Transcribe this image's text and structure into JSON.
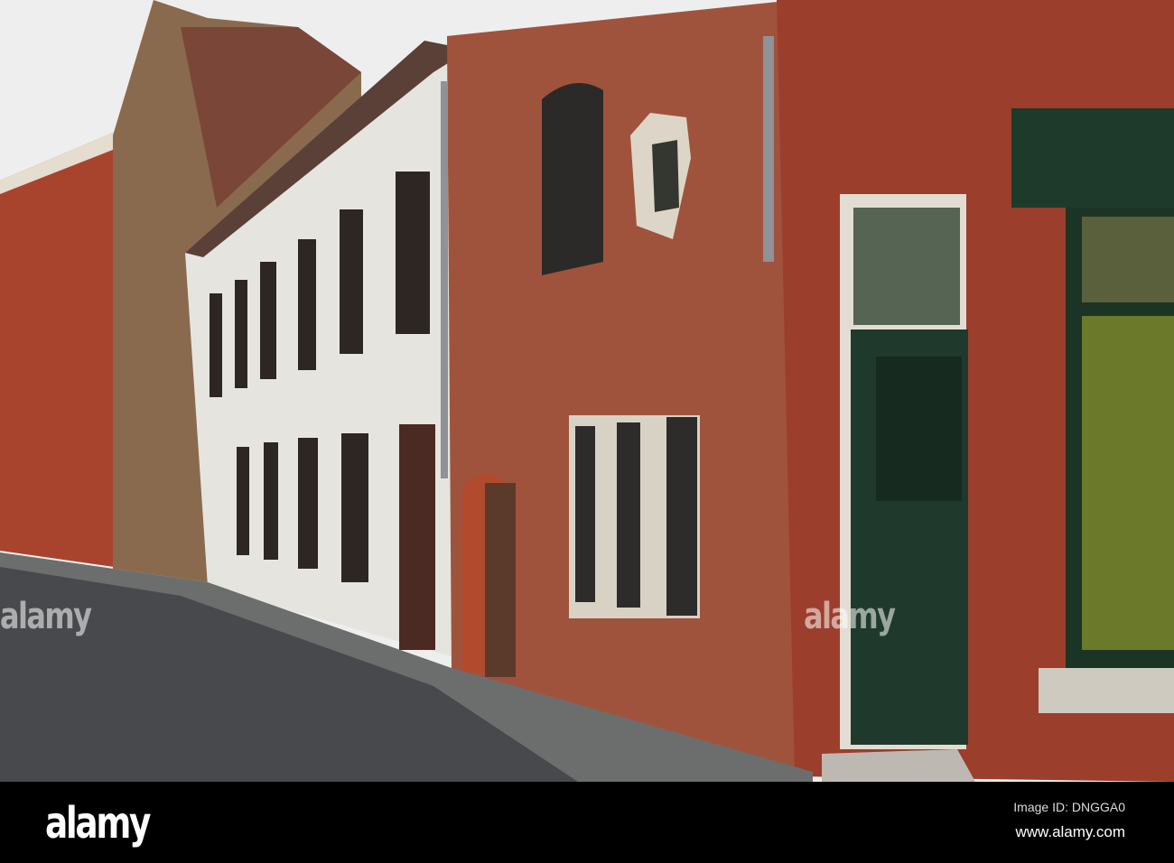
{
  "photo": {
    "subject": "Street of brick and whitewashed houses",
    "colors": {
      "sky": "#eeeeee",
      "brick": "#a0452f",
      "white_wall": "#e8e6e0",
      "road": "#4a4b4e",
      "door_green": "#1f3a2c"
    }
  },
  "watermark": {
    "text": "alamy"
  },
  "footer": {
    "logo": "alamy",
    "image_id": "Image ID: DNGGA0",
    "site": "www.alamy.com"
  }
}
